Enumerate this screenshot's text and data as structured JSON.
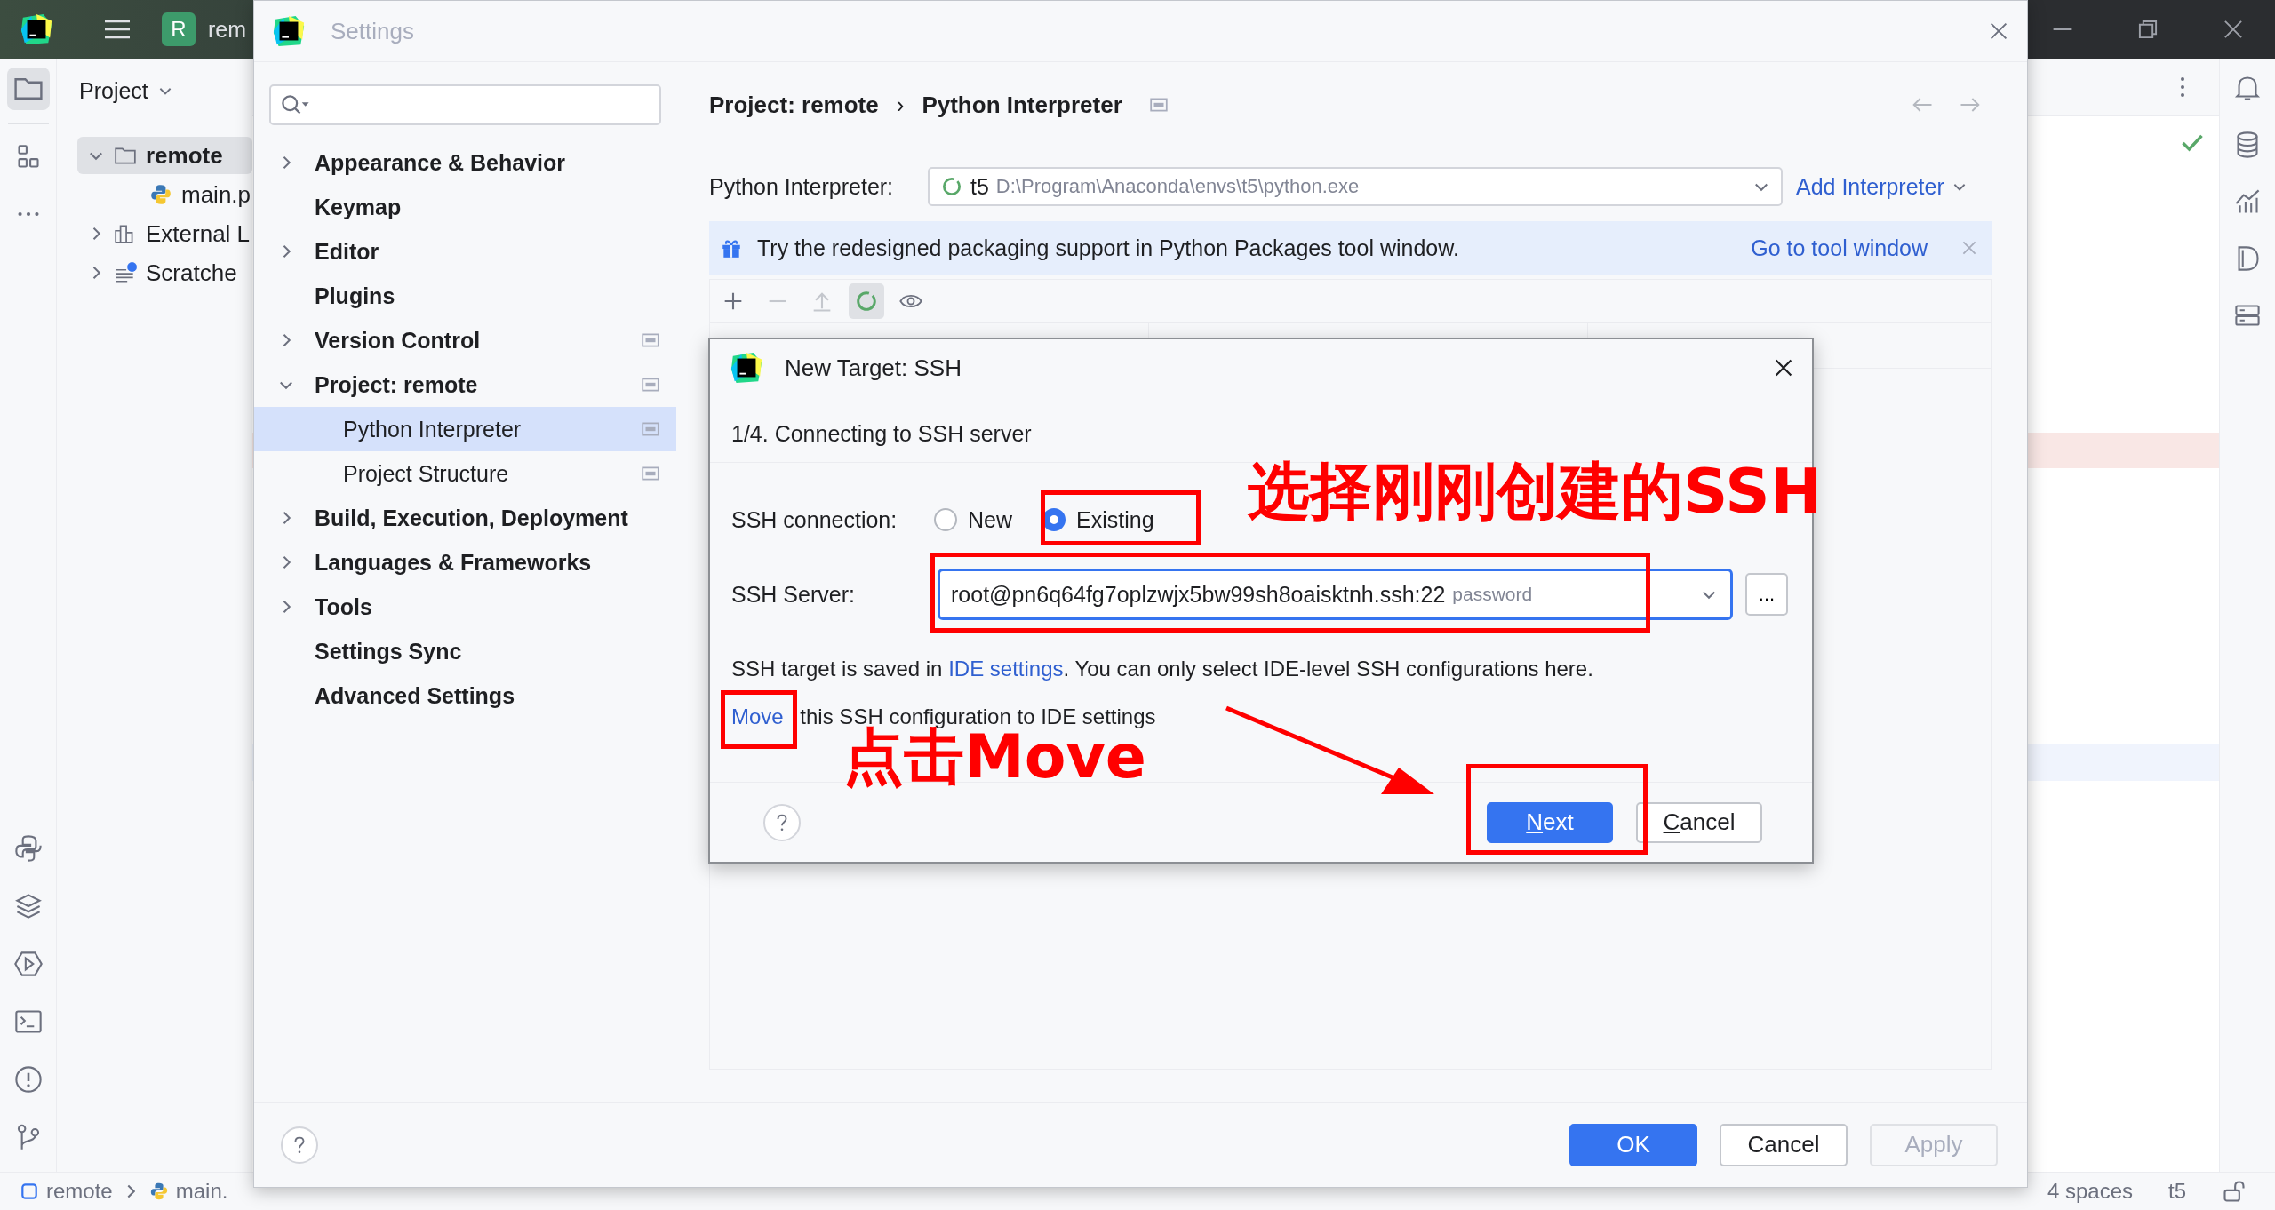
{
  "ide": {
    "title_bar": {
      "project_badge": "R",
      "project_name": "rem"
    },
    "project_panel": {
      "title": "Project",
      "tree": [
        {
          "label": "remote",
          "kind": "folder",
          "expanded": true,
          "selected": true,
          "children": [
            {
              "label": "main.p",
              "kind": "python",
              "selected": false
            }
          ]
        },
        {
          "label": "External L",
          "kind": "library",
          "expanded": false,
          "selected": false
        },
        {
          "label": "Scratche",
          "kind": "scratches",
          "expanded": false,
          "selected": false
        }
      ]
    },
    "status_bar": {
      "path": [
        {
          "label": "remote",
          "kind": "module"
        },
        {
          "label": "main.",
          "kind": "python"
        }
      ],
      "indent": "4 spaces",
      "interpreter": "t5"
    }
  },
  "settings": {
    "title": "Settings",
    "nav": [
      {
        "label": "Appearance & Behavior",
        "expanded": false,
        "selected": false,
        "project_level": false
      },
      {
        "label": "Keymap",
        "selected": false,
        "project_level": false
      },
      {
        "label": "Editor",
        "expanded": false,
        "selected": false,
        "project_level": false
      },
      {
        "label": "Plugins",
        "selected": false,
        "project_level": false
      },
      {
        "label": "Version Control",
        "expanded": false,
        "selected": false,
        "project_level": true
      },
      {
        "label": "Project: remote",
        "expanded": true,
        "selected": false,
        "project_level": true,
        "children": [
          {
            "label": "Python Interpreter",
            "selected": true,
            "project_level": true
          },
          {
            "label": "Project Structure",
            "selected": false,
            "project_level": true
          }
        ]
      },
      {
        "label": "Build, Execution, Deployment",
        "expanded": false,
        "selected": false,
        "project_level": false
      },
      {
        "label": "Languages & Frameworks",
        "expanded": false,
        "selected": false,
        "project_level": false
      },
      {
        "label": "Tools",
        "expanded": false,
        "selected": false,
        "project_level": false
      },
      {
        "label": "Settings Sync",
        "selected": false,
        "project_level": false
      },
      {
        "label": "Advanced Settings",
        "selected": false,
        "project_level": false
      }
    ],
    "breadcrumb": [
      "Project: remote",
      "Python Interpreter"
    ],
    "breadcrumb_separator": "›",
    "interpreter": {
      "label": "Python Interpreter:",
      "name": "t5",
      "path": "D:\\Program\\Anaconda\\envs\\t5\\python.exe",
      "add_label": "Add Interpreter"
    },
    "banner": {
      "text": "Try the redesigned packaging support in Python Packages tool window.",
      "link": "Go to tool window"
    },
    "toolbar": [
      {
        "kind": "add",
        "disabled": false,
        "selected": false
      },
      {
        "kind": "remove",
        "disabled": true,
        "selected": false
      },
      {
        "kind": "upgrade",
        "disabled": true,
        "selected": false
      },
      {
        "kind": "reload",
        "disabled": false,
        "selected": true
      },
      {
        "kind": "show",
        "disabled": false,
        "selected": false
      }
    ],
    "buttons": [
      {
        "label": "OK",
        "kind": "primary"
      },
      {
        "label": "Cancel",
        "kind": "default"
      },
      {
        "label": "Apply",
        "kind": "disabled"
      }
    ]
  },
  "ssh_dialog": {
    "title": "New Target: SSH",
    "step": "1/4. Connecting to SSH server",
    "connection_label": "SSH connection:",
    "options": [
      {
        "label": "New",
        "selected": false,
        "highlighted": false
      },
      {
        "label": "Existing",
        "selected": true,
        "highlighted": true
      }
    ],
    "server_label": "SSH Server:",
    "server": {
      "value": "root@pn6q64fg7oplzwjx5bw99sh8oaisktnh.ssh:22",
      "hint": "password",
      "highlighted": true
    },
    "browse": "...",
    "info": {
      "before": "SSH target is saved in ",
      "link": "IDE settings",
      "after": ". You can only select IDE-level SSH configurations here."
    },
    "move": {
      "link": "Move",
      "after": " this SSH configuration to IDE settings",
      "highlighted": true
    },
    "buttons": [
      {
        "label": "Next",
        "kind": "primary",
        "highlighted": true
      },
      {
        "label": "Cancel",
        "kind": "default",
        "highlighted": false
      }
    ]
  },
  "annotations": [
    {
      "text": "选择刚刚创建的SSH"
    },
    {
      "text": "点击Move"
    }
  ]
}
